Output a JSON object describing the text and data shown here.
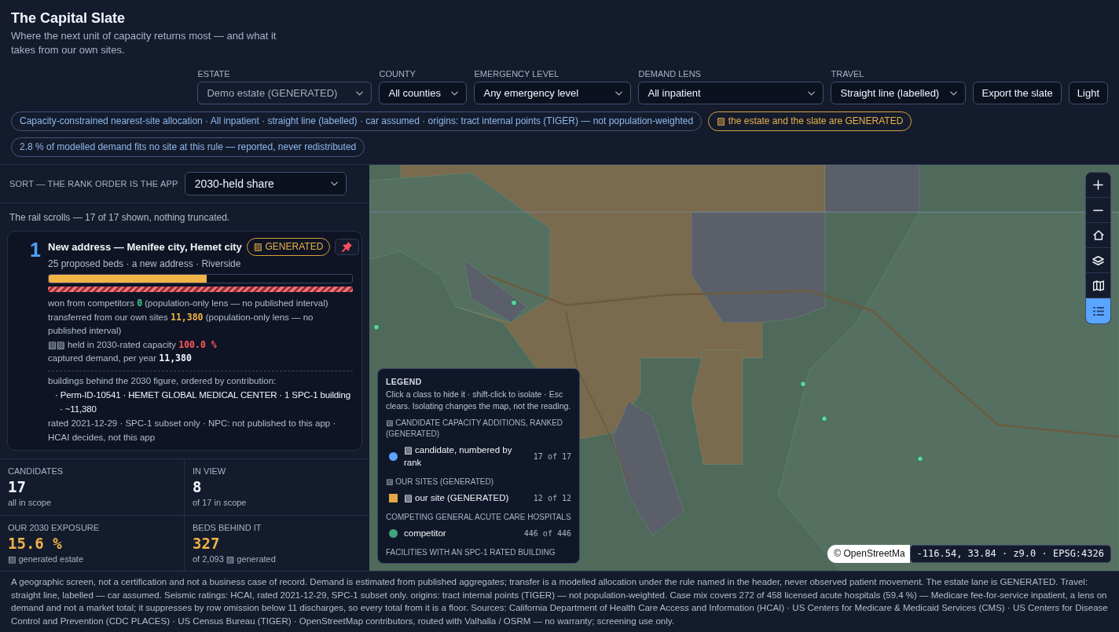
{
  "header": {
    "title": "The Capital Slate",
    "subtitle": "Where the next unit of capacity returns most — and what it takes from our own sites."
  },
  "filters": [
    {
      "label": "ESTATE",
      "value": "Demo estate (GENERATED)",
      "disabled": true
    },
    {
      "label": "COUNTY",
      "value": "All counties",
      "disabled": false
    },
    {
      "label": "EMERGENCY LEVEL",
      "value": "Any emergency level",
      "disabled": false
    },
    {
      "label": "DEMAND LENS",
      "value": "All inpatient",
      "disabled": false
    },
    {
      "label": "TRAVEL",
      "value": "Straight line (labelled)",
      "disabled": false
    }
  ],
  "buttons": [
    "Export the slate",
    "Light"
  ],
  "chips": [
    {
      "kind": "note",
      "text": "Capacity-constrained nearest-site allocation · All inpatient · straight line (labelled) · car assumed · origins: tract internal points (TIGER) — not population-weighted"
    },
    {
      "kind": "generated",
      "text": "▨ the estate and the slate are GENERATED"
    },
    {
      "kind": "note",
      "text": "2.8 % of modelled demand fits no site at this rule — reported, never redistributed"
    }
  ],
  "rail": {
    "sort_label": "SORT — THE RANK ORDER IS THE APP",
    "sort_value": "2030-held share",
    "note": "The rail scrolls — 17 of 17 shown, nothing truncated.",
    "candidates": [
      {
        "rank": "1",
        "title": "New address — Menifee city, Hemet city",
        "badge": "▨ GENERATED",
        "summary": "25 proposed beds · a new address · Riverside",
        "share_bar": {
          "level": 0.52
        },
        "metrics": [
          {
            "kind": "won",
            "label": "won from competitors",
            "value": "0",
            "note": "(population-only lens — no published interval)"
          },
          {
            "kind": "transfer",
            "label": "transferred from our own sites",
            "value": "11,380",
            "note": "(population-only lens — no published interval)"
          },
          {
            "kind": "held",
            "label": "▨▨ held in 2030-rated capacity",
            "value": "100.0 %"
          },
          {
            "kind": "captured",
            "label": "captured demand, per year",
            "value": "11,380"
          }
        ],
        "buildings_heading": "buildings behind the 2030 figure, ordered by contribution:",
        "buildings": [
          "· Perm-ID-10541 · HEMET GLOBAL MEDICAL CENTER · 1 SPC-1 building · ~11,380"
        ],
        "rating_note": "rated 2021-12-29 · SPC-1 subset only · NPC: not published to this app · HCAI decides, not this app"
      }
    ]
  },
  "stats": [
    {
      "kind": "count",
      "label": "CANDIDATES",
      "value": "17",
      "note": "all in scope"
    },
    {
      "kind": "count",
      "label": "IN VIEW",
      "value": "8",
      "note": "of 17 in scope"
    },
    {
      "kind": "exposure",
      "label": "OUR 2030 EXPOSURE",
      "value": "15.6 %",
      "note": "▨ generated estate"
    },
    {
      "kind": "exposure",
      "label": "BEDS BEHIND IT",
      "value": "327",
      "note": "of 2,093 ▨ generated"
    }
  ],
  "map": {
    "tools": [
      {
        "kind": "zoom_in",
        "selected": false
      },
      {
        "kind": "zoom_out",
        "selected": false
      },
      {
        "kind": "home",
        "selected": false
      },
      {
        "kind": "layers",
        "selected": false
      },
      {
        "kind": "basemap",
        "selected": false
      },
      {
        "kind": "legend",
        "selected": true
      }
    ],
    "legend": {
      "title": "LEGEND",
      "hint": "Click a class to hide it · shift-click to isolate · Esc clears. Isolating changes the map, not the reading.",
      "groups": [
        {
          "heading": "▨ CANDIDATE CAPACITY ADDITIONS, RANKED (GENERATED)",
          "classes": [
            {
              "kind": "dot",
              "color": "#5aa5ff",
              "label": "▨ candidate, numbered by rank",
              "count": "17 of 17"
            }
          ]
        },
        {
          "heading": "▨ OUR SITES (GENERATED)",
          "classes": [
            {
              "kind": "square",
              "color": "#e3a944",
              "label": "▨ our site (GENERATED)",
              "count": "12 of 12"
            }
          ]
        },
        {
          "heading": "COMPETING GENERAL ACUTE CARE HOSPITALS",
          "classes": [
            {
              "kind": "dot",
              "color": "#3fa57c",
              "label": "competitor",
              "count": "446 of 446"
            }
          ]
        },
        {
          "heading": "FACILITIES WITH AN SPC-1 RATED BUILDING"
        }
      ]
    },
    "attribution": "© OpenStreetMa",
    "coordinates": "-116.54, 33.84 · z9.0 · EPSG:4326"
  },
  "footer": "A geographic screen, not a certification and not a business case of record. Demand is estimated from published aggregates; transfer is a modelled allocation under the rule named in the header, never observed patient movement. The estate lane is GENERATED. Travel: straight line, labelled — car assumed. Seismic ratings: HCAI, rated 2021-12-29, SPC-1 subset only. origins: tract internal points (TIGER) — not population-weighted. Case mix covers 272 of 458 licensed acute hospitals (59.4 %) — Medicare fee-for-service inpatient, a lens on demand and not a market total; it suppresses by row omission below 11 discharges, so every total from it is a floor. Sources: California Department of Health Care Access and Information (HCAI) · US Centers for Medicare & Medicaid Services (CMS) · US Centers for Disease Control and Prevention (CDC PLACES) · US Census Bureau (TIGER) · OpenStreetMap contributors, routed with Valhalla / OSRM — no warranty; screening use only."
}
